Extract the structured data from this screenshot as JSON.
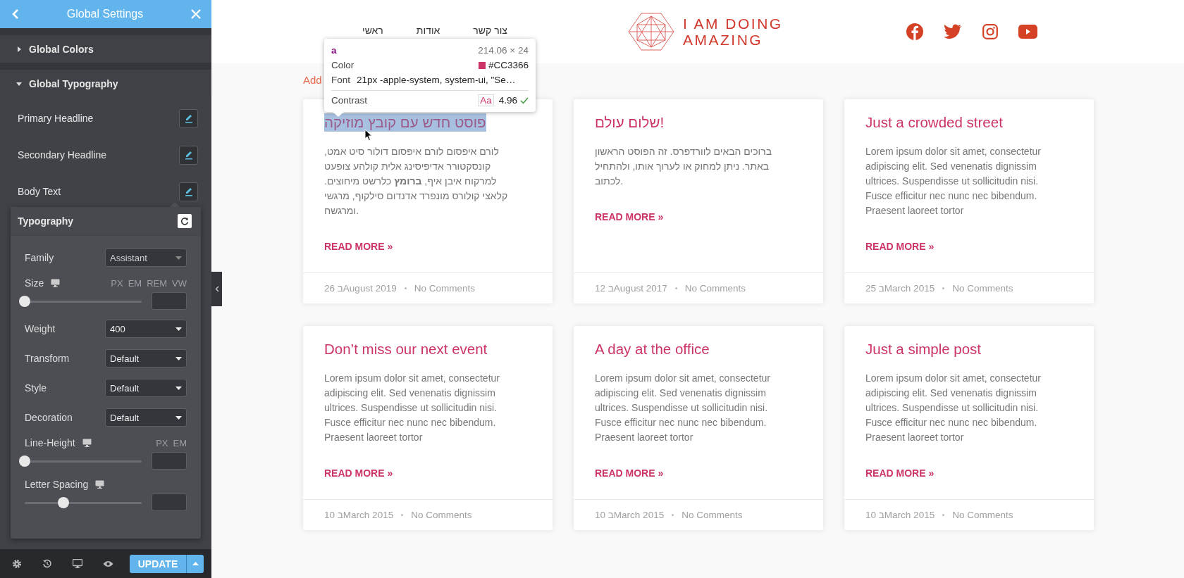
{
  "panel": {
    "title": "Global Settings",
    "sections": [
      {
        "label": "Global Colors",
        "expanded": false
      },
      {
        "label": "Global Typography",
        "expanded": true
      }
    ],
    "typography_items": [
      {
        "label": "Primary Headline"
      },
      {
        "label": "Secondary Headline"
      },
      {
        "label": "Body Text"
      }
    ],
    "popover": {
      "title": "Typography",
      "controls": [
        {
          "kind": "select",
          "label": "Family",
          "value": "Assistant",
          "disabled": true
        },
        {
          "kind": "slider",
          "label": "Size",
          "units": [
            "PX",
            "EM",
            "REM",
            "VW"
          ],
          "level": 0
        },
        {
          "kind": "select",
          "label": "Weight",
          "value": "400",
          "disabled": false
        },
        {
          "kind": "select",
          "label": "Transform",
          "value": "Default",
          "disabled": false
        },
        {
          "kind": "select",
          "label": "Style",
          "value": "Default",
          "disabled": false
        },
        {
          "kind": "select",
          "label": "Decoration",
          "value": "Default",
          "disabled": false
        },
        {
          "kind": "slider",
          "label": "Line-Height",
          "units": [
            "PX",
            "EM"
          ],
          "level": 0
        },
        {
          "kind": "slider",
          "label": "Letter Spacing",
          "level": 0.33
        }
      ]
    },
    "update_button": "UPDATE"
  },
  "site": {
    "nav": [
      "צור קשר",
      "אודות",
      "ראשי"
    ],
    "logo": [
      "I AM DOING",
      "AMAZING"
    ],
    "add_text": "Add",
    "posts": [
      {
        "title": "פוסט חדש עם קובץ מוזיקה",
        "highlighted": true,
        "excerpt": "לורם איפסום לורם איפסום דולור סיט אמט, קונסקטורר אדיפיסינג אלית קולהע צופעט למרקוח איבן איף, **ברומץ** כלרשט מיחוצים. קלאצי קולורס מונפרד אדנדום סילקוף, מרגשי ומרגשח.",
        "read_more": "READ MORE »",
        "date": "26 בAugust 2019",
        "comments": "No Comments"
      },
      {
        "title": "שלום עולם!",
        "highlighted": false,
        "excerpt": "ברוכים הבאים לוורדפרס. זה הפוסט הראשון באתר. ניתן למחוק או לערוך אותו, ולהתחיל לכתוב.",
        "read_more": "READ MORE »",
        "date": "12 בAugust 2017",
        "comments": "No Comments"
      },
      {
        "title": "Just a crowded street",
        "highlighted": false,
        "excerpt": "Lorem ipsum dolor sit amet, consectetur adipiscing elit. Sed venenatis dignissim ultrices. Suspendisse ut sollicitudin nisi. Fusce efficitur nec nunc nec bibendum. Praesent laoreet tortor",
        "read_more": "READ MORE »",
        "date": "25 בMarch 2015",
        "comments": "No Comments"
      },
      {
        "title": "Don’t miss our next event",
        "highlighted": false,
        "excerpt": "Lorem ipsum dolor sit amet, consectetur adipiscing elit. Sed venenatis dignissim ultrices. Suspendisse ut sollicitudin nisi. Fusce efficitur nec nunc nec bibendum. Praesent laoreet tortor",
        "read_more": "READ MORE »",
        "date": "10 בMarch 2015",
        "comments": "No Comments"
      },
      {
        "title": "A day at the office",
        "highlighted": false,
        "excerpt": "Lorem ipsum dolor sit amet, consectetur adipiscing elit. Sed venenatis dignissim ultrices. Suspendisse ut sollicitudin nisi. Fusce efficitur nec nunc nec bibendum. Praesent laoreet tortor",
        "read_more": "READ MORE »",
        "date": "10 בMarch 2015",
        "comments": "No Comments"
      },
      {
        "title": "Just a simple post",
        "highlighted": false,
        "excerpt": "Lorem ipsum dolor sit amet, consectetur adipiscing elit. Sed venenatis dignissim ultrices. Suspendisse ut sollicitudin nisi. Fusce efficitur nec nunc nec bibendum. Praesent laoreet tortor",
        "read_more": "READ MORE »",
        "date": "10 בMarch 2015",
        "comments": "No Comments"
      }
    ]
  },
  "inspector_tooltip": {
    "tag": "a",
    "size": "214.06 × 24",
    "color_label": "Color",
    "color": "#cc3366",
    "color_value": "#CC3366",
    "font_label": "Font",
    "font_value": "21px -apple-system, system-ui, \"Se…",
    "contrast_label": "Contrast",
    "contrast_sample": "Aa",
    "contrast_value": "4.96",
    "contrast_pass": true
  }
}
